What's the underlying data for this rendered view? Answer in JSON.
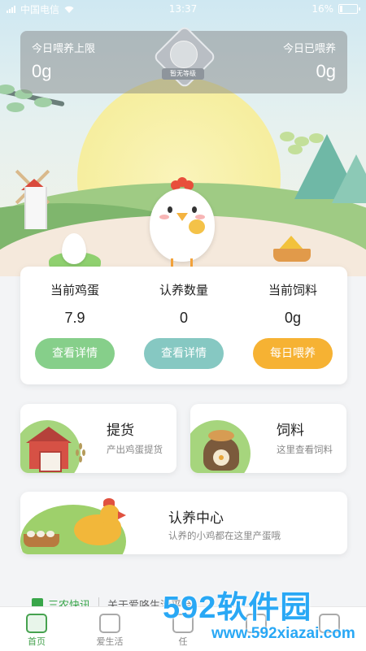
{
  "status_bar": {
    "carrier": "中国电信",
    "time": "13:37",
    "battery": "16%",
    "battery_level": 0.16
  },
  "feeding": {
    "limit_label": "今日喂养上限",
    "limit_value": "0g",
    "fed_label": "今日已喂养",
    "fed_value": "0g",
    "badge_text": "暂无等级"
  },
  "stats": [
    {
      "label": "当前鸡蛋",
      "value": "7.9",
      "button": "查看详情",
      "color": "#86cf8a"
    },
    {
      "label": "认养数量",
      "value": "0",
      "button": "查看详情",
      "color": "#86c8c2"
    },
    {
      "label": "当前饲料",
      "value": "0g",
      "button": "每日喂养",
      "color": "#f6b233"
    }
  ],
  "cards": {
    "pickup": {
      "title": "提货",
      "subtitle": "产出鸡蛋提货"
    },
    "feed": {
      "title": "饲料",
      "subtitle": "这里查看饲料"
    },
    "adopt": {
      "title": "认养中心",
      "subtitle": "认养的小鸡都在这里产蛋哦"
    }
  },
  "news": {
    "label": "三农快讯",
    "text": "关于爱咯生活平台"
  },
  "tabs": [
    {
      "label": "首页",
      "icon": "home-icon",
      "active": true
    },
    {
      "label": "爱生活",
      "icon": "shop-icon",
      "active": false
    },
    {
      "label": "任",
      "icon": "task-icon",
      "active": false
    },
    {
      "label": "",
      "icon": "cart-icon",
      "active": false
    },
    {
      "label": "",
      "icon": "user-icon",
      "active": false
    }
  ],
  "watermark": {
    "brand": "592软件园",
    "url": "www.592xiazai.com"
  }
}
